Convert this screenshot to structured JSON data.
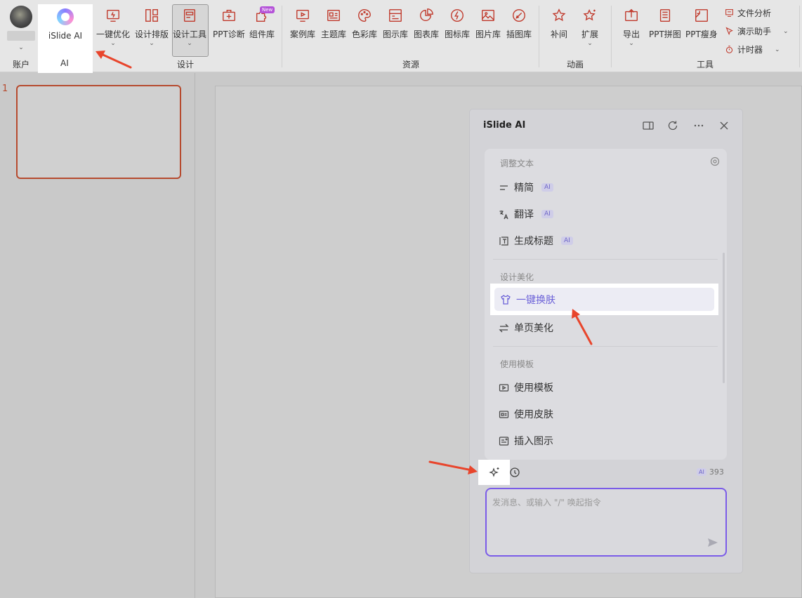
{
  "ribbon": {
    "account_label": "账户",
    "islide_ai": "iSlide AI",
    "group_ai": "AI",
    "design_buttons": [
      "一键优化",
      "设计排版",
      "设计工具",
      "PPT诊断",
      "组件库"
    ],
    "new_badge": "New",
    "group_design": "设计",
    "resource_buttons": [
      "案例库",
      "主题库",
      "色彩库",
      "图示库",
      "图表库",
      "图标库",
      "图片库",
      "插图库"
    ],
    "group_resources": "资源",
    "animation_buttons": [
      "补间",
      "扩展"
    ],
    "group_animation": "动画",
    "tool_buttons": [
      "导出",
      "PPT拼图",
      "PPT瘦身"
    ],
    "tool_list": [
      "文件分析",
      "演示助手",
      "计时器"
    ],
    "group_tools": "工具"
  },
  "slides": {
    "slide_number": "1"
  },
  "panel": {
    "title": "iSlide AI",
    "sections": {
      "adjust_text": "调整文本",
      "design_beautify": "设计美化",
      "use_template": "使用模板"
    },
    "items": {
      "simplify": "精简",
      "translate": "翻译",
      "gen_title": "生成标题",
      "one_click_skin": "一键换肤",
      "page_beautify": "单页美化",
      "use_template": "使用模板",
      "use_skin": "使用皮肤",
      "insert_diagram": "插入图示"
    },
    "ai_tag": "AI",
    "count": "393",
    "input_placeholder": "发消息、或输入 \"/\" 唤起指令"
  },
  "colors": {
    "accent": "#6c62d8",
    "input_border": "#7b5ce8",
    "arrow": "#e8452c",
    "slide_border": "#b64a2e"
  }
}
